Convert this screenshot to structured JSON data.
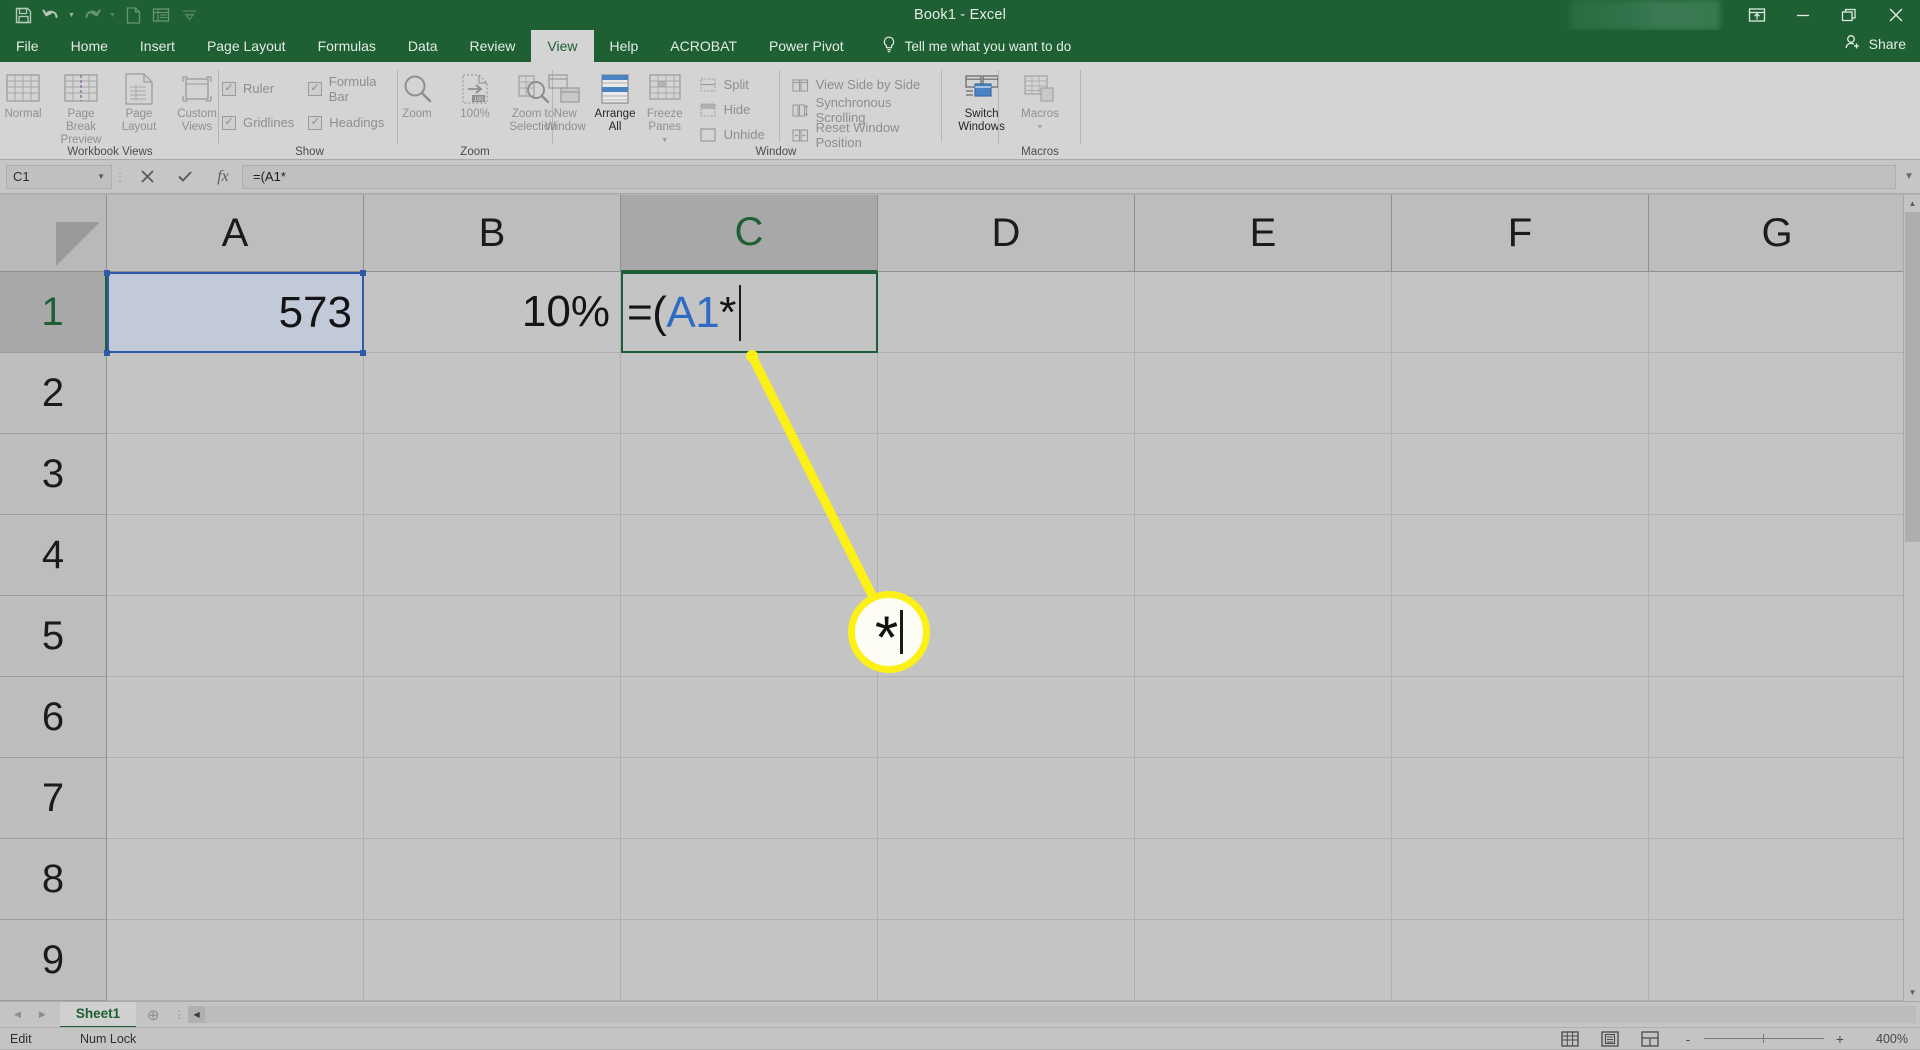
{
  "window": {
    "title": "Book1 - Excel",
    "quick_access": [
      "save-icon",
      "undo-icon",
      "redo-icon",
      "new-icon",
      "print-preview-icon",
      "customize-qat-icon"
    ],
    "controls": [
      "ribbon-display-options-icon",
      "minimize-icon",
      "restore-icon",
      "close-icon"
    ],
    "share_label": "Share"
  },
  "tabs": [
    {
      "label": "File",
      "active": false
    },
    {
      "label": "Home",
      "active": false
    },
    {
      "label": "Insert",
      "active": false
    },
    {
      "label": "Page Layout",
      "active": false
    },
    {
      "label": "Formulas",
      "active": false
    },
    {
      "label": "Data",
      "active": false
    },
    {
      "label": "Review",
      "active": false
    },
    {
      "label": "View",
      "active": true
    },
    {
      "label": "Help",
      "active": false
    },
    {
      "label": "ACROBAT",
      "active": false
    },
    {
      "label": "Power Pivot",
      "active": false
    }
  ],
  "tellme": {
    "placeholder": "Tell me what you want to do",
    "icon": "lightbulb-icon"
  },
  "ribbon": {
    "groups": [
      {
        "name": "Workbook Views",
        "label": "Workbook Views",
        "buttons": [
          {
            "label": "Normal",
            "icon": "normal-view-icon",
            "enabled": false
          },
          {
            "label": "Page Break Preview",
            "icon": "page-break-preview-icon",
            "enabled": false
          },
          {
            "label": "Page Layout",
            "icon": "page-layout-icon",
            "enabled": false
          },
          {
            "label": "Custom Views",
            "icon": "custom-views-icon",
            "enabled": false
          }
        ]
      },
      {
        "name": "Show",
        "label": "Show",
        "checkboxes": [
          {
            "label": "Ruler",
            "checked": true
          },
          {
            "label": "Formula Bar",
            "checked": true
          },
          {
            "label": "Gridlines",
            "checked": true
          },
          {
            "label": "Headings",
            "checked": true
          }
        ]
      },
      {
        "name": "Zoom",
        "label": "Zoom",
        "buttons": [
          {
            "label": "Zoom",
            "icon": "magnifier-icon",
            "enabled": false
          },
          {
            "label": "100%",
            "icon": "zoom-100-icon",
            "enabled": false
          },
          {
            "label": "Zoom to Selection",
            "icon": "zoom-to-selection-icon",
            "enabled": false
          }
        ]
      },
      {
        "name": "Window",
        "label": "Window",
        "buttons": [
          {
            "label": "New Window",
            "icon": "new-window-icon",
            "enabled": false
          },
          {
            "label": "Arrange All",
            "icon": "arrange-all-icon",
            "enabled": true
          },
          {
            "label": "Freeze Panes",
            "icon": "freeze-panes-icon",
            "enabled": false
          }
        ],
        "small_buttons": [
          {
            "label": "Split",
            "icon": "split-icon"
          },
          {
            "label": "Hide",
            "icon": "hide-icon"
          },
          {
            "label": "Unhide",
            "icon": "unhide-icon"
          },
          {
            "label": "View Side by Side",
            "icon": "view-side-by-side-icon"
          },
          {
            "label": "Synchronous Scrolling",
            "icon": "synchronous-scrolling-icon"
          },
          {
            "label": "Reset Window Position",
            "icon": "reset-window-position-icon"
          }
        ],
        "switch_windows": {
          "label": "Switch Windows",
          "icon": "switch-windows-icon",
          "enabled": true
        }
      },
      {
        "name": "Macros",
        "label": "Macros",
        "buttons": [
          {
            "label": "Macros",
            "icon": "macros-icon",
            "enabled": false
          }
        ]
      }
    ]
  },
  "formula_bar": {
    "name_box": "C1",
    "cancel_icon": "cancel-x-icon",
    "enter_icon": "enter-check-icon",
    "function_icon": "insert-function-fx-icon",
    "value": "=(A1*",
    "expand_icon": "expand-formula-bar-icon"
  },
  "grid": {
    "columns": [
      "A",
      "B",
      "C",
      "D",
      "E",
      "F",
      "G"
    ],
    "rows": [
      "1",
      "2",
      "3",
      "4",
      "5",
      "6",
      "7",
      "8",
      "9"
    ],
    "selected_column": "C",
    "selected_row": "1",
    "cells": {
      "A1": "573",
      "B1": "10%"
    },
    "editing_cell": {
      "ref": "C1",
      "tokens": [
        {
          "text": "=(",
          "color": "#141414"
        },
        {
          "text": "A1",
          "color": "#2f6bc4"
        },
        {
          "text": "*",
          "color": "#141414"
        }
      ]
    }
  },
  "callout": {
    "symbol": "*",
    "line_color": "#fdf017",
    "ring_color": "#fdf017"
  },
  "sheet_bar": {
    "prev_icon": "prev-sheet-icon",
    "next_icon": "next-sheet-icon",
    "sheets": [
      "Sheet1"
    ],
    "active_sheet": "Sheet1",
    "add_sheet_icon": "add-sheet-icon"
  },
  "status_bar": {
    "mode": "Edit",
    "num_lock": "Num Lock",
    "views": [
      "normal-view-icon",
      "page-layout-view-icon",
      "page-break-preview-icon"
    ],
    "zoom_out": "-",
    "zoom_in": "+",
    "zoom_level": "400%"
  }
}
